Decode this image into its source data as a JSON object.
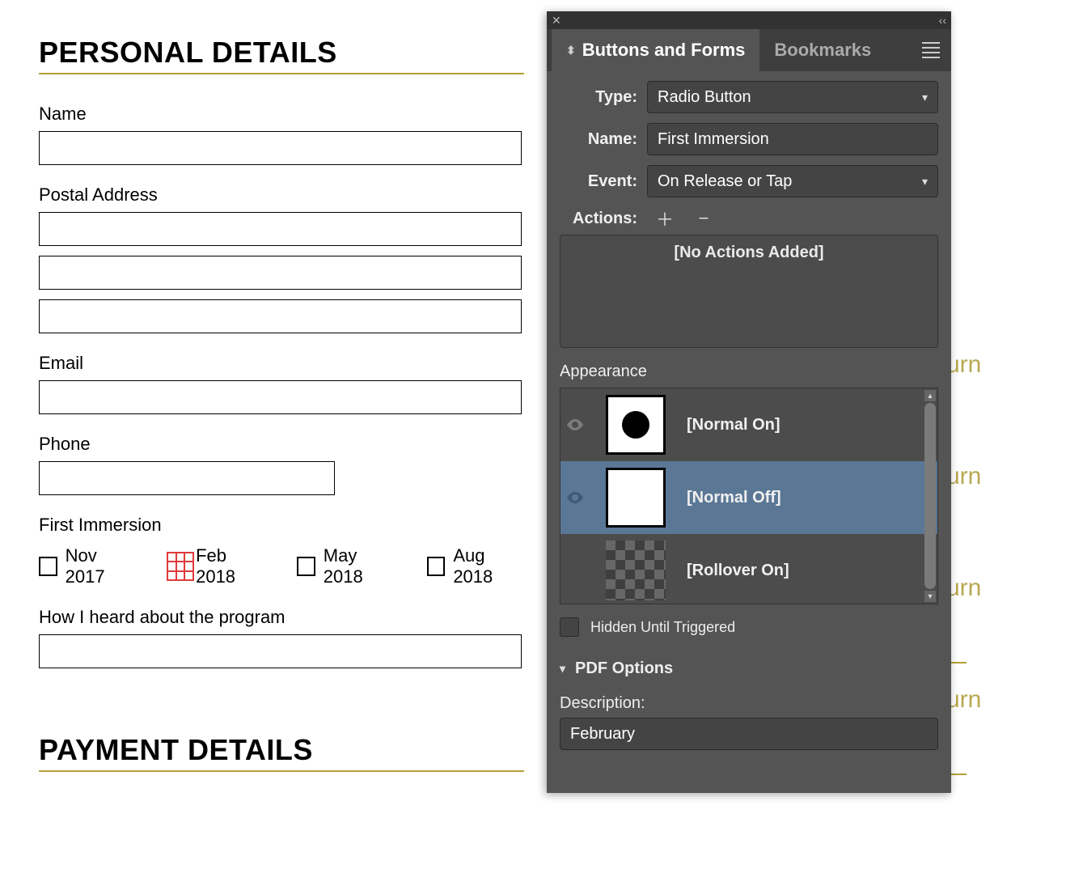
{
  "doc": {
    "section1": "PERSONAL DETAILS",
    "section2": "PAYMENT DETAILS",
    "labels": {
      "name": "Name",
      "postal": "Postal Address",
      "email": "Email",
      "phone": "Phone",
      "immersion": "First Immersion",
      "heard": "How I heard about the program"
    },
    "immersion_options": [
      "Nov 2017",
      "Feb 2018",
      "May 2018",
      "Aug 2018"
    ]
  },
  "bg_peek": [
    "urn",
    "urn",
    "urn",
    "urn"
  ],
  "panel": {
    "tabs": {
      "active": "Buttons and Forms",
      "inactive": "Bookmarks"
    },
    "type": {
      "label": "Type:",
      "value": "Radio Button"
    },
    "name": {
      "label": "Name:",
      "value": "First Immersion"
    },
    "event": {
      "label": "Event:",
      "value": "On Release or Tap"
    },
    "actions": {
      "label": "Actions:",
      "empty": "[No Actions Added]"
    },
    "appearance": {
      "label": "Appearance",
      "states": [
        {
          "label": "[Normal On]",
          "kind": "on",
          "selected": false
        },
        {
          "label": "[Normal Off]",
          "kind": "off",
          "selected": true
        },
        {
          "label": "[Rollover On]",
          "kind": "checker",
          "selected": false
        }
      ]
    },
    "hidden": "Hidden Until Triggered",
    "pdf_options": "PDF Options",
    "description": {
      "label": "Description:",
      "value": "February"
    }
  }
}
